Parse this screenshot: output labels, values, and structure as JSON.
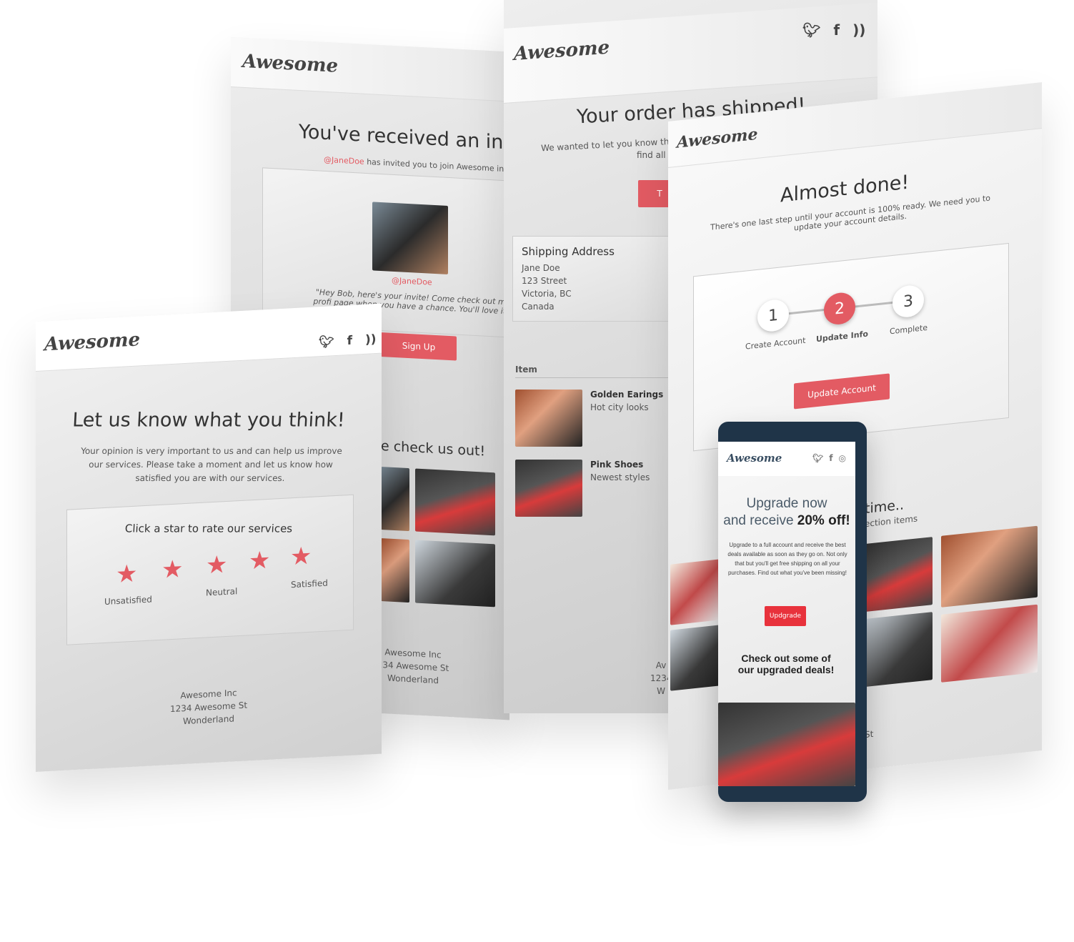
{
  "brand": "Awesome",
  "social_icons": [
    "twitter-icon",
    "facebook-icon",
    "rss-icon"
  ],
  "accent": "#e35b63",
  "invite": {
    "title": "You've received an invit",
    "mention": "@JaneDoe",
    "subtitle": " has invited you to join Awesome inc!",
    "username": "@JaneDoe",
    "quote": "\"Hey Bob, here's your invite! Come check out my profi page when you have a chance. You'll love it!\"",
    "button": "Sign Up",
    "section": "e check us out!",
    "footer": [
      "Awesome Inc",
      "234 Awesome St",
      "Wonderland"
    ]
  },
  "shipped": {
    "title": "Your order has shipped!",
    "text1": "We wanted to let you know that w",
    "text2": "find all t",
    "button": "T",
    "shipping_title": "Shipping Address",
    "address": [
      "Jane Doe",
      "123 Street",
      "Victoria, BC",
      "Canada"
    ],
    "items_header": "Item",
    "items": [
      {
        "name": "Golden Earings",
        "desc": "Hot city looks"
      },
      {
        "name": "Pink Shoes",
        "desc": "Newest styles"
      }
    ],
    "footer": [
      "Av",
      "1234",
      "W"
    ]
  },
  "almost": {
    "title": "Almost done!",
    "text": "There's one last step until your account is 100% ready. We need you to update your account details.",
    "steps": [
      {
        "n": "1",
        "label": "Create Account"
      },
      {
        "n": "2",
        "label": "Update Info"
      },
      {
        "n": "3",
        "label": "Complete"
      }
    ],
    "button": "Update Account",
    "section_title": "time..",
    "section_sub": "ection items",
    "footer": "St"
  },
  "feedback": {
    "title": "Let us know what you think!",
    "text": "Your opinion is very important to us and can help us improve our services. Please take a moment and let us know how satisfied you are with our services.",
    "card_title": "Click a star to rate our services",
    "labels": [
      "Unsatisfied",
      "Neutral",
      "Satisfied"
    ],
    "footer": [
      "Awesome Inc",
      "1234 Awesome St",
      "Wonderland"
    ]
  },
  "mobile": {
    "social_icons": [
      "twitter-icon",
      "facebook-icon",
      "instagram-icon"
    ],
    "title1": "Upgrade now",
    "title2": "and receive ",
    "title_bold": "20% off!",
    "text": "Upgrade to a full account and receive the best deals available as soon as they go on. Not only that but you'll get free shipping on all your purchases. Find out what you've been missing!",
    "button": "Updgrade",
    "section": "Check out some of our upgraded deals!"
  }
}
